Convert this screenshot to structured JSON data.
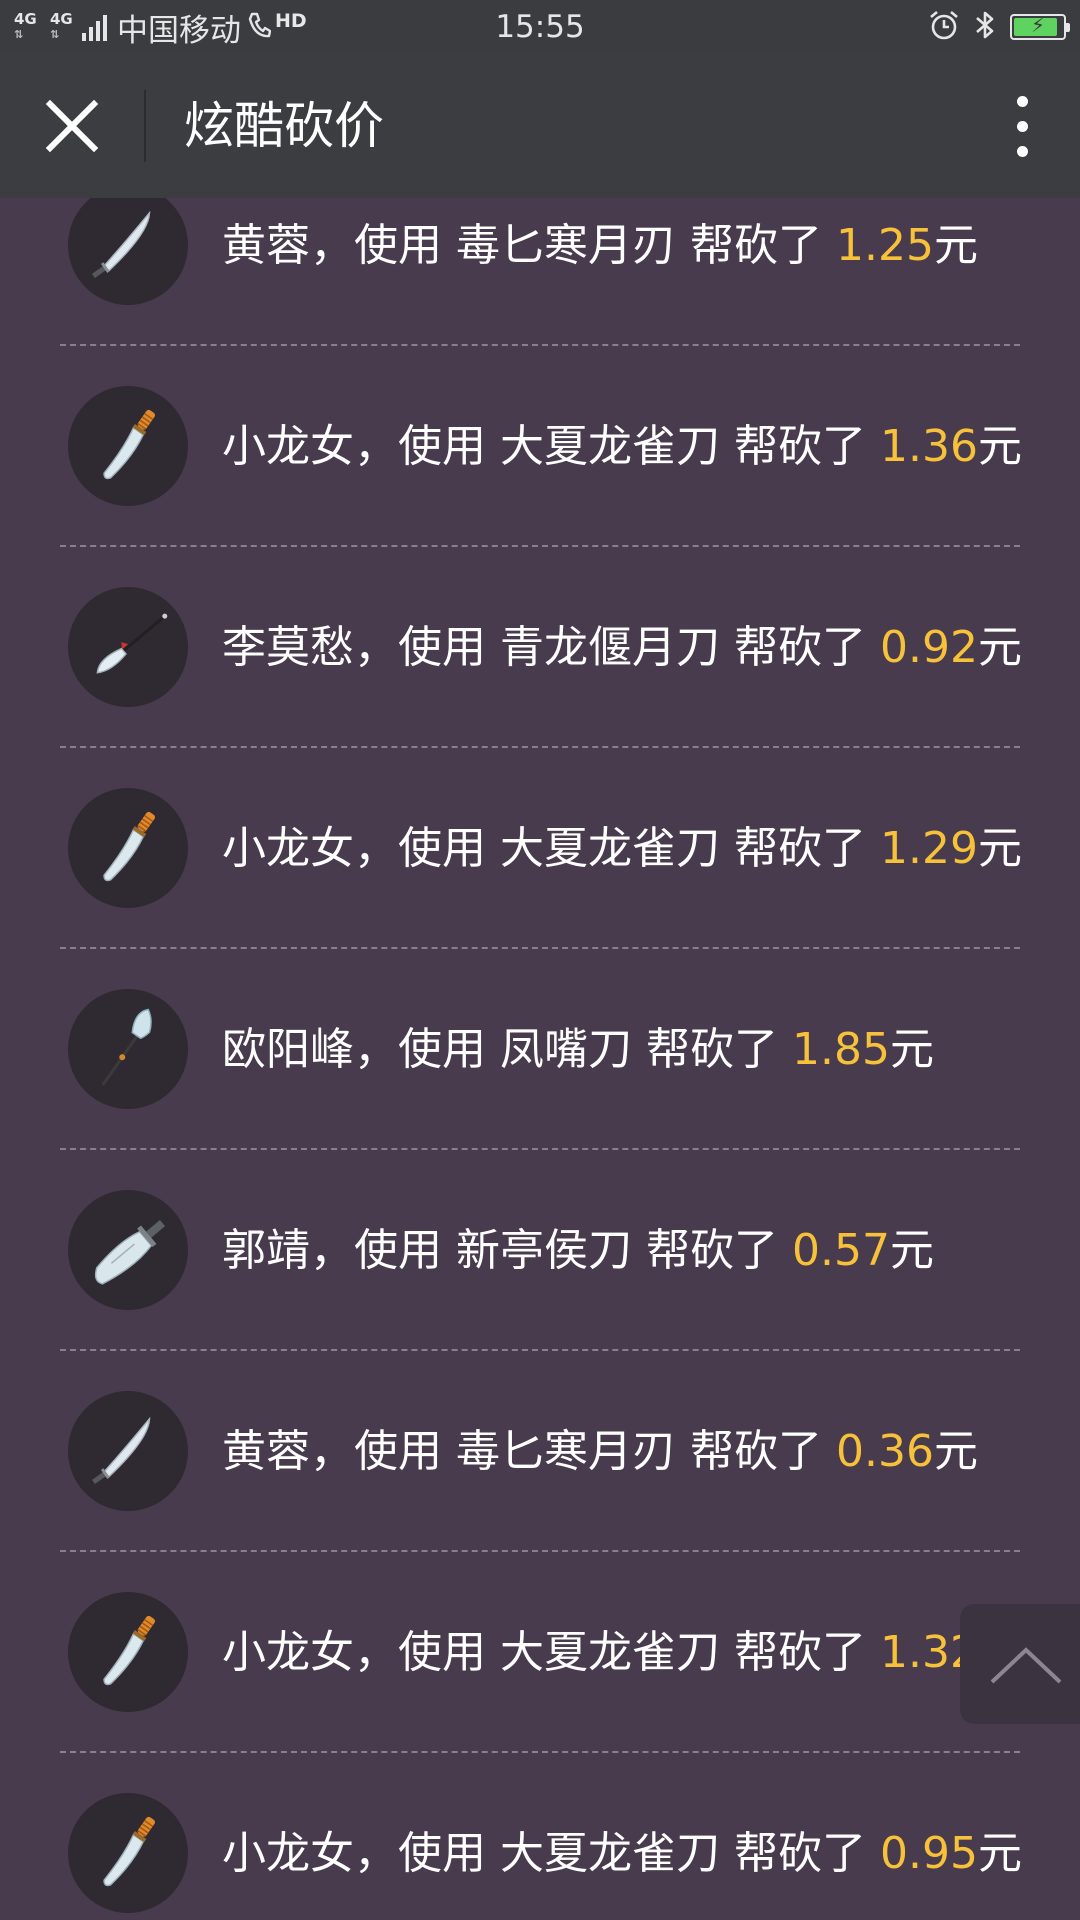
{
  "status_bar": {
    "network": "4G",
    "network2": "4G",
    "carrier": "中国移动",
    "hd_label": "HD",
    "time": "15:55",
    "icons": [
      "alarm-icon",
      "bluetooth-icon",
      "battery-charging-icon"
    ],
    "battery_level": 0.82
  },
  "title_bar": {
    "title": "炫酷砍价",
    "close_icon": "close-icon",
    "more_icon": "more-vertical-icon"
  },
  "rows": [
    {
      "name": "黄蓉",
      "mid": "，使用 ",
      "weapon": "毒匕寒月刃",
      "action": " 帮砍了 ",
      "amount": "1.25",
      "unit": "元",
      "icon": "curved-blade-icon"
    },
    {
      "name": "小龙女",
      "mid": "，使用 ",
      "weapon": "大夏龙雀刀",
      "action": " 帮砍了 ",
      "amount": "1.36",
      "unit": "元",
      "icon": "dragon-sparrow-blade-icon"
    },
    {
      "name": "李莫愁",
      "mid": "，使用 ",
      "weapon": "青龙偃月刀",
      "action": " 帮砍了 ",
      "amount": "0.92",
      "unit": "元",
      "icon": "glaive-icon"
    },
    {
      "name": "小龙女",
      "mid": "，使用 ",
      "weapon": "大夏龙雀刀",
      "action": " 帮砍了 ",
      "amount": "1.29",
      "unit": "元",
      "icon": "dragon-sparrow-blade-icon"
    },
    {
      "name": "欧阳峰",
      "mid": "，使用 ",
      "weapon": "凤嘴刀",
      "action": " 帮砍了 ",
      "amount": "1.85",
      "unit": "元",
      "icon": "phoenix-beak-blade-icon"
    },
    {
      "name": "郭靖",
      "mid": "，使用 ",
      "weapon": "新亭侯刀",
      "action": " 帮砍了 ",
      "amount": "0.57",
      "unit": "元",
      "icon": "broad-blade-icon"
    },
    {
      "name": "黄蓉",
      "mid": "，使用 ",
      "weapon": "毒匕寒月刃",
      "action": " 帮砍了 ",
      "amount": "0.36",
      "unit": "元",
      "icon": "curved-blade-icon"
    },
    {
      "name": "小龙女",
      "mid": "，使用 ",
      "weapon": "大夏龙雀刀",
      "action": " 帮砍了 ",
      "amount": "1.32",
      "unit": "元",
      "icon": "dragon-sparrow-blade-icon"
    },
    {
      "name": "小龙女",
      "mid": "，使用 ",
      "weapon": "大夏龙雀刀",
      "action": " 帮砍了 ",
      "amount": "0.95",
      "unit": "元",
      "icon": "dragon-sparrow-blade-icon"
    }
  ],
  "back_to_top": {
    "icon": "chevron-up-icon"
  },
  "colors": {
    "background": "#473b4d",
    "title_bar": "#3b3d41",
    "amount": "#f7c23a",
    "text": "#ffffff"
  }
}
